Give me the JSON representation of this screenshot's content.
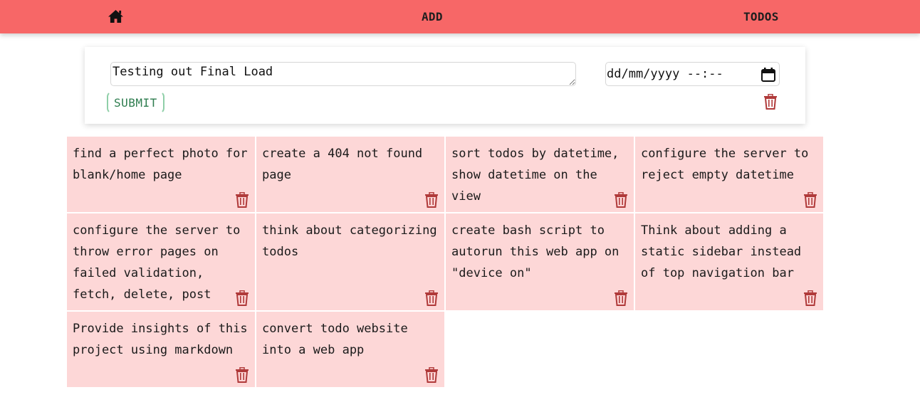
{
  "nav": {
    "home_icon": "home-icon",
    "add_label": "ADD",
    "todos_label": "TODOS"
  },
  "form": {
    "todo_value": "Testing out Final Load",
    "date_placeholder": "dd/mm/yyyy --:--",
    "submit_label": "SUBMIT",
    "calendar_icon": "calendar-icon",
    "trash_icon": "trash-icon"
  },
  "colors": {
    "navbar": "#f76767",
    "card": "#fdd7d7",
    "trash": "#b03a3a",
    "submit_text": "#2e7d4f"
  },
  "todos": [
    {
      "text": "find a perfect photo for blank/home page"
    },
    {
      "text": "create a 404 not found page"
    },
    {
      "text": "sort todos by datetime, show datetime on the view"
    },
    {
      "text": "configure the server to reject empty datetime"
    },
    {
      "text": "configure the server to throw error pages on failed validation, fetch, delete, post"
    },
    {
      "text": "think about categorizing todos"
    },
    {
      "text": "create bash script to autorun this web app on \"device on\""
    },
    {
      "text": "Think about adding a static sidebar instead of top navigation bar"
    },
    {
      "text": "Provide insights of this project using markdown"
    },
    {
      "text": "convert todo website into a web app"
    }
  ]
}
